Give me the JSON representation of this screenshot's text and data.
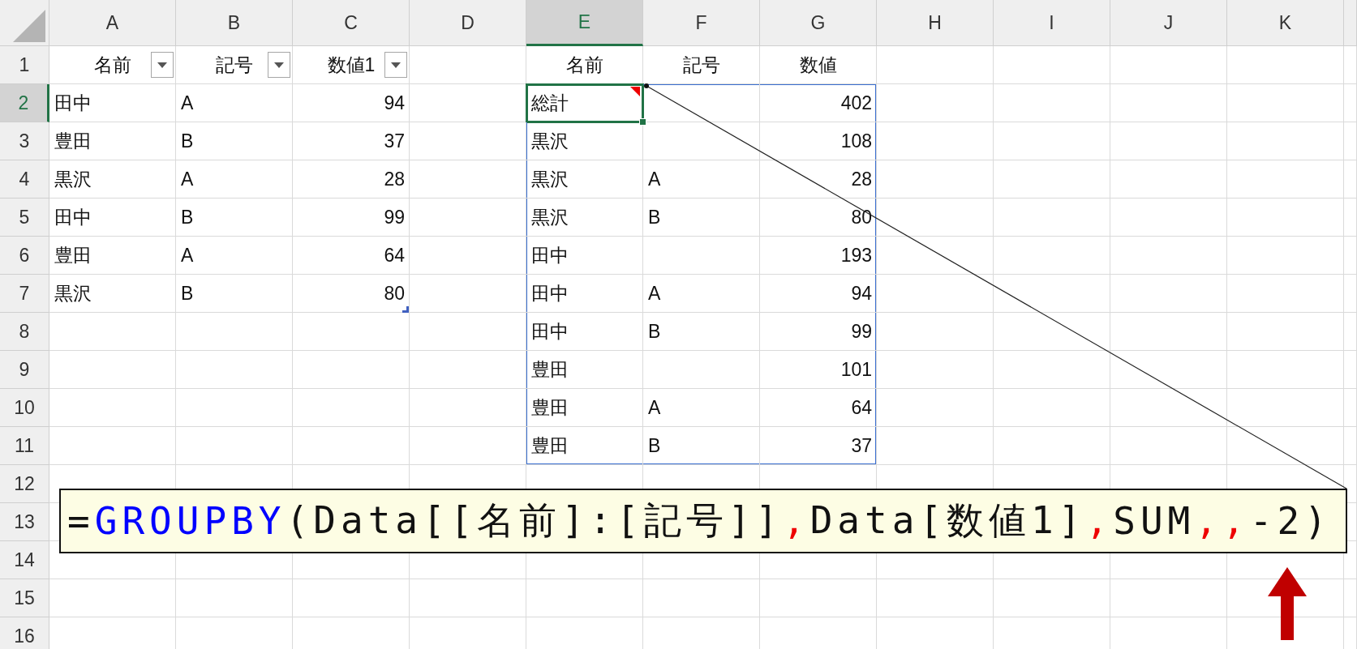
{
  "sheet": {
    "columns": [
      {
        "label": "A",
        "selected": false
      },
      {
        "label": "B",
        "selected": false
      },
      {
        "label": "C",
        "selected": false
      },
      {
        "label": "D",
        "selected": false
      },
      {
        "label": "E",
        "selected": true
      },
      {
        "label": "F",
        "selected": false
      },
      {
        "label": "G",
        "selected": false
      },
      {
        "label": "H",
        "selected": false
      },
      {
        "label": "I",
        "selected": false
      },
      {
        "label": "J",
        "selected": false
      },
      {
        "label": "K",
        "selected": false
      },
      {
        "selected": false
      }
    ],
    "rows": [
      {
        "label": "1",
        "selected": false,
        "cells": {
          "col_a": {
            "text": "名前",
            "kind": "heading",
            "filter": true
          },
          "col_b": {
            "text": "記号",
            "kind": "heading",
            "filter": true
          },
          "col_c": {
            "text": "数値1",
            "kind": "heading",
            "filter": true
          },
          "col_e": {
            "text": "名前",
            "kind": "heading"
          },
          "col_f": {
            "text": "記号",
            "kind": "heading"
          },
          "col_g": {
            "text": "数値",
            "kind": "heading"
          }
        }
      },
      {
        "label": "2",
        "selected": true,
        "cells": {
          "col_a": {
            "text": "田中",
            "kind": "text"
          },
          "col_b": {
            "text": "A",
            "kind": "text"
          },
          "col_c": {
            "text": "94",
            "kind": "number"
          },
          "col_e": {
            "text": "総計",
            "kind": "text",
            "selected": true,
            "note": true
          },
          "col_f": {
            "spill_top": true
          },
          "col_g": {
            "text": "402",
            "kind": "number",
            "spill_top": true,
            "spill_right": true
          }
        }
      },
      {
        "label": "3",
        "selected": false,
        "cells": {
          "col_a": {
            "text": "豊田",
            "kind": "text"
          },
          "col_b": {
            "text": "B",
            "kind": "text"
          },
          "col_c": {
            "text": "37",
            "kind": "number"
          },
          "col_e": {
            "text": "黒沢",
            "kind": "text",
            "spill_left": true
          },
          "col_g": {
            "text": "108",
            "kind": "number",
            "spill_right": true
          }
        }
      },
      {
        "label": "4",
        "selected": false,
        "cells": {
          "col_a": {
            "text": "黒沢",
            "kind": "text"
          },
          "col_b": {
            "text": "A",
            "kind": "text"
          },
          "col_c": {
            "text": "28",
            "kind": "number"
          },
          "col_e": {
            "text": "黒沢",
            "kind": "text",
            "spill_left": true
          },
          "col_f": {
            "text": "A",
            "kind": "text"
          },
          "col_g": {
            "text": "28",
            "kind": "number",
            "spill_right": true
          }
        }
      },
      {
        "label": "5",
        "selected": false,
        "cells": {
          "col_a": {
            "text": "田中",
            "kind": "text"
          },
          "col_b": {
            "text": "B",
            "kind": "text"
          },
          "col_c": {
            "text": "99",
            "kind": "number"
          },
          "col_e": {
            "text": "黒沢",
            "kind": "text",
            "spill_left": true
          },
          "col_f": {
            "text": "B",
            "kind": "text"
          },
          "col_g": {
            "text": "80",
            "kind": "number",
            "spill_right": true
          }
        }
      },
      {
        "label": "6",
        "selected": false,
        "cells": {
          "col_a": {
            "text": "豊田",
            "kind": "text"
          },
          "col_b": {
            "text": "A",
            "kind": "text"
          },
          "col_c": {
            "text": "64",
            "kind": "number"
          },
          "col_e": {
            "text": "田中",
            "kind": "text",
            "spill_left": true
          },
          "col_g": {
            "text": "193",
            "kind": "number",
            "spill_right": true
          }
        }
      },
      {
        "label": "7",
        "selected": false,
        "cells": {
          "col_a": {
            "text": "黒沢",
            "kind": "text"
          },
          "col_b": {
            "text": "B",
            "kind": "text"
          },
          "col_c": {
            "text": "80",
            "kind": "number",
            "table_end": true
          },
          "col_e": {
            "text": "田中",
            "kind": "text",
            "spill_left": true
          },
          "col_f": {
            "text": "A",
            "kind": "text"
          },
          "col_g": {
            "text": "94",
            "kind": "number",
            "spill_right": true
          }
        }
      },
      {
        "label": "8",
        "selected": false,
        "cells": {
          "col_e": {
            "text": "田中",
            "kind": "text",
            "spill_left": true
          },
          "col_f": {
            "text": "B",
            "kind": "text"
          },
          "col_g": {
            "text": "99",
            "kind": "number",
            "spill_right": true
          }
        }
      },
      {
        "label": "9",
        "selected": false,
        "cells": {
          "col_e": {
            "text": "豊田",
            "kind": "text",
            "spill_left": true
          },
          "col_g": {
            "text": "101",
            "kind": "number",
            "spill_right": true
          }
        }
      },
      {
        "label": "10",
        "selected": false,
        "cells": {
          "col_e": {
            "text": "豊田",
            "kind": "text",
            "spill_left": true
          },
          "col_f": {
            "text": "A",
            "kind": "text"
          },
          "col_g": {
            "text": "64",
            "kind": "number",
            "spill_right": true
          }
        }
      },
      {
        "label": "11",
        "selected": false,
        "cells": {
          "col_e": {
            "text": "豊田",
            "kind": "text",
            "spill_bottom": true,
            "spill_left": true
          },
          "col_f": {
            "text": "B",
            "kind": "text",
            "spill_bottom": true
          },
          "col_g": {
            "text": "37",
            "kind": "number",
            "spill_bottom": true,
            "spill_right": true
          }
        }
      },
      {
        "label": "12",
        "selected": false,
        "cells": {}
      },
      {
        "label": "13",
        "selected": false,
        "cells": {}
      },
      {
        "label": "14",
        "selected": false,
        "cells": {}
      },
      {
        "label": "15",
        "selected": false,
        "cells": {}
      },
      {
        "label": "16",
        "selected": false,
        "cells": {}
      }
    ]
  },
  "formula_callout": {
    "parts": [
      {
        "text": "=",
        "kind": "plain"
      },
      {
        "text": "GROUPBY",
        "kind": "function"
      },
      {
        "text": "(Data[[名前]:[記号]]",
        "kind": "plain"
      },
      {
        "text": ",",
        "kind": "separator"
      },
      {
        "text": "Data[数値1]",
        "kind": "plain"
      },
      {
        "text": ",",
        "kind": "separator"
      },
      {
        "text": "SUM",
        "kind": "plain"
      },
      {
        "text": ",,",
        "kind": "separator"
      },
      {
        "text": "-2)",
        "kind": "plain"
      }
    ]
  }
}
